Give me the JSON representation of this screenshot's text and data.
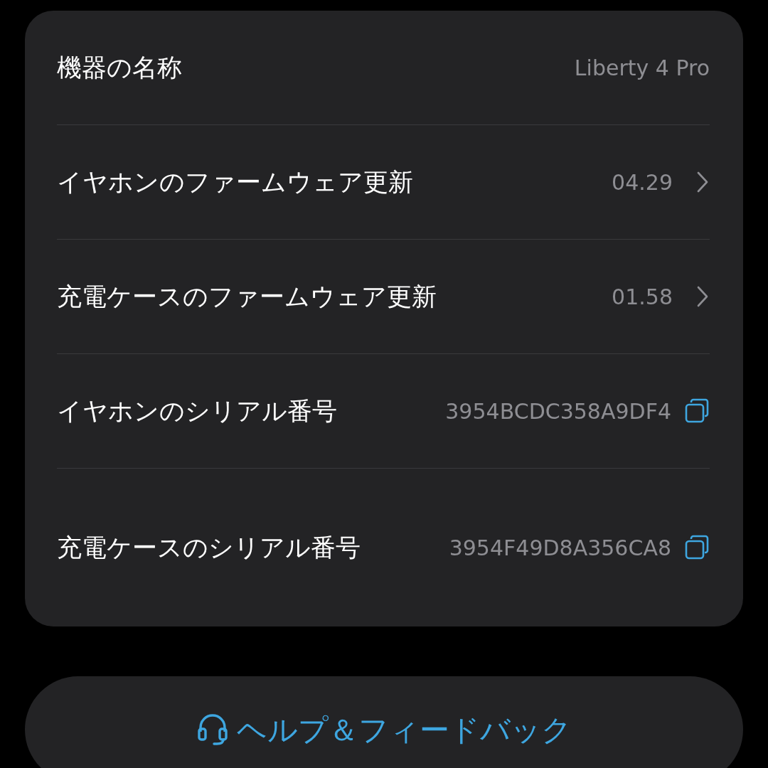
{
  "device_info": {
    "rows": [
      {
        "kind": "value",
        "label": "機器の名称",
        "value": "Liberty 4 Pro"
      },
      {
        "kind": "link",
        "label": "イヤホンのファームウェア更新",
        "value": "04.29"
      },
      {
        "kind": "link",
        "label": "充電ケースのファームウェア更新",
        "value": "01.58"
      },
      {
        "kind": "copy",
        "label": "イヤホンのシリアル番号",
        "value": "3954BCDC358A9DF4"
      },
      {
        "kind": "copy",
        "label": "充電ケースのシリアル番号",
        "value": "3954F49D8A356CA8"
      }
    ]
  },
  "help_button": {
    "label": "ヘルプ＆フィードバック"
  }
}
